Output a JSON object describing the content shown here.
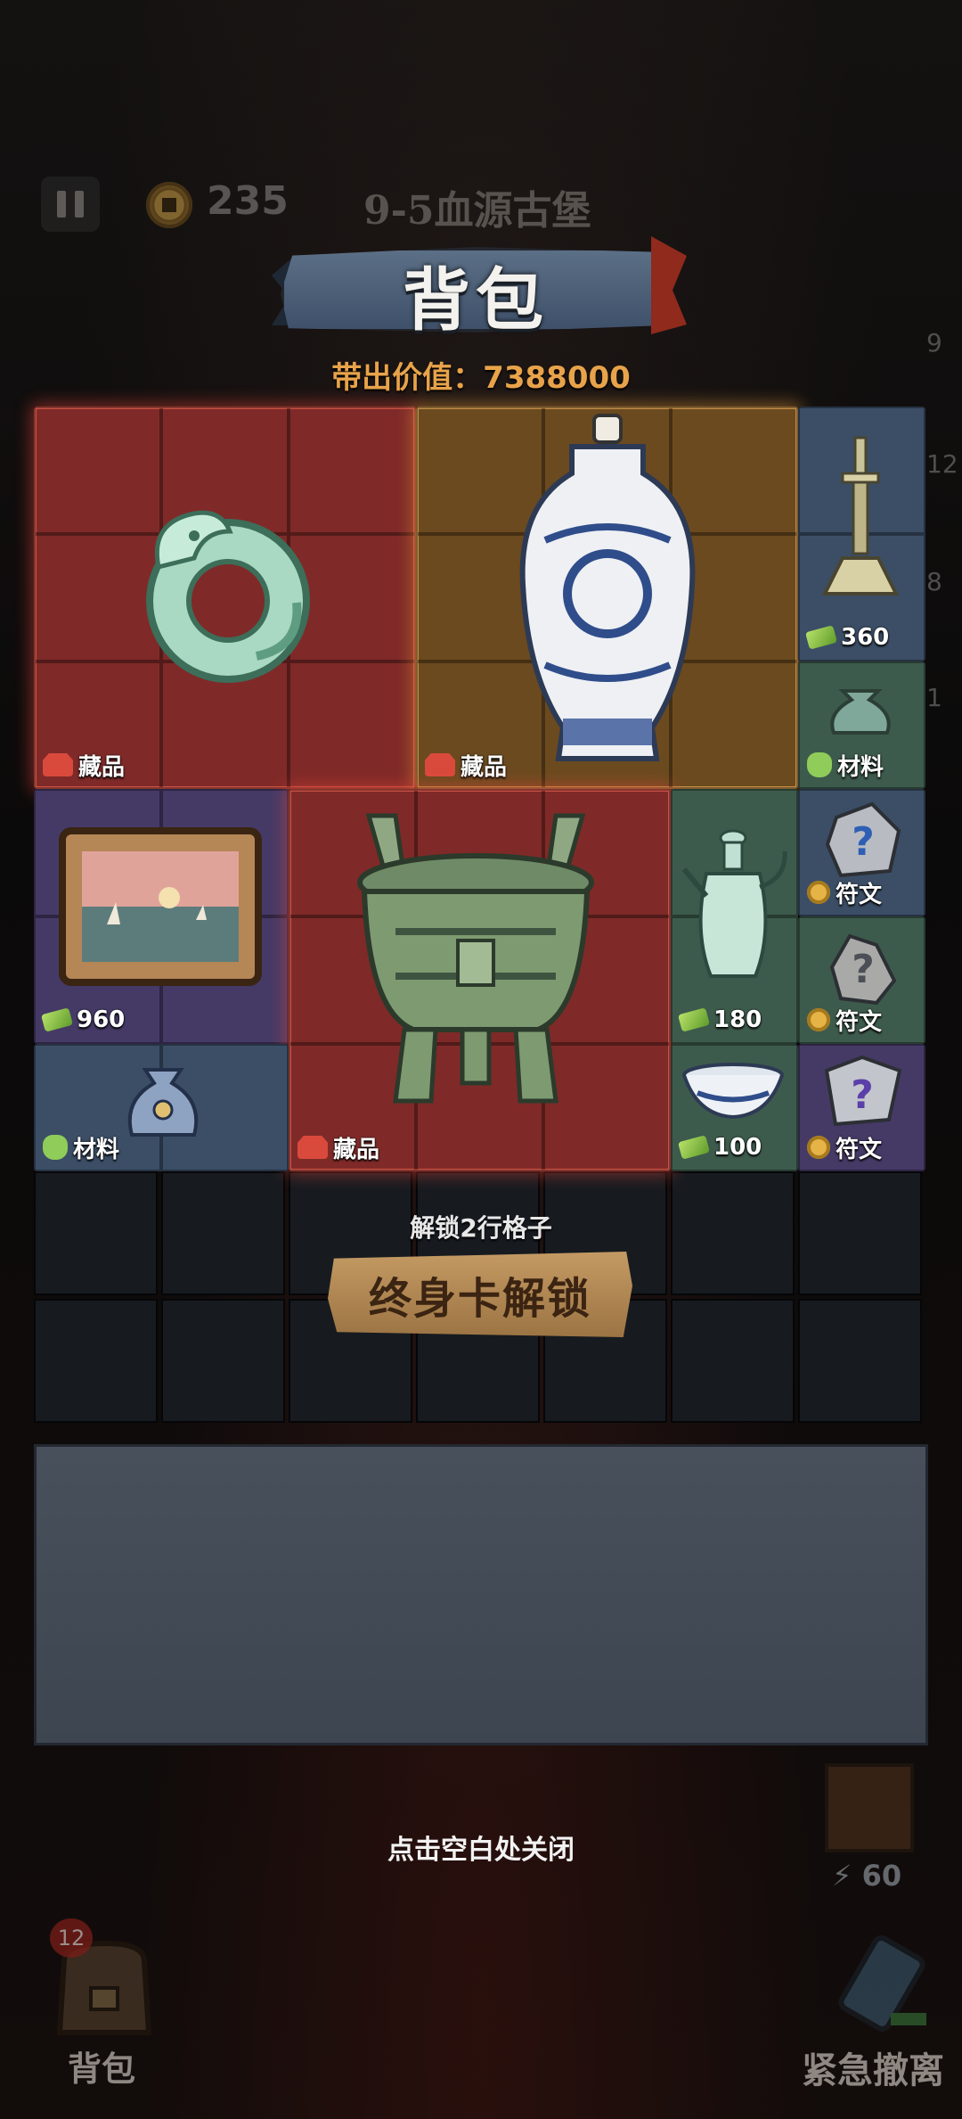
{
  "hud": {
    "coins": "235",
    "stage": "9-5血源古堡"
  },
  "title": "背包",
  "carry_value_label": "带出价值：7388000",
  "side_numbers": [
    "9",
    "12",
    "8",
    "1"
  ],
  "items": [
    {
      "id": "jade-dragon",
      "tag": "藏品",
      "tag_icon": "collection-icon",
      "color": "#7f2a28"
    },
    {
      "id": "blue-white-vase",
      "tag": "藏品",
      "tag_icon": "collection-icon",
      "color": "#6b4a1f"
    },
    {
      "id": "candlestick",
      "tag": "360",
      "tag_icon": "cash-icon"
    },
    {
      "id": "material-sack-green",
      "tag": "材料",
      "tag_icon": "material-icon"
    },
    {
      "id": "painting",
      "tag": "960",
      "tag_icon": "cash-icon"
    },
    {
      "id": "bronze-ding",
      "tag": "藏品",
      "tag_icon": "collection-icon"
    },
    {
      "id": "celadon-ewer",
      "tag": "180",
      "tag_icon": "cash-icon"
    },
    {
      "id": "rune-stone-1",
      "tag": "符文",
      "tag_icon": "rune-icon"
    },
    {
      "id": "rune-stone-2",
      "tag": "符文",
      "tag_icon": "rune-icon"
    },
    {
      "id": "material-sack-blue",
      "tag": "材料",
      "tag_icon": "material-icon"
    },
    {
      "id": "porcelain-bowl",
      "tag": "100",
      "tag_icon": "cash-icon"
    },
    {
      "id": "rune-stone-3",
      "tag": "符文",
      "tag_icon": "rune-icon"
    }
  ],
  "unlock": {
    "hint": "解锁2行格子",
    "button": "终身卡解锁"
  },
  "close_hint": "点击空白处关闭",
  "bottom": {
    "backpack_badge": "12",
    "backpack_label": "背包",
    "energy": "60",
    "escape_label": "紧急撤离"
  }
}
